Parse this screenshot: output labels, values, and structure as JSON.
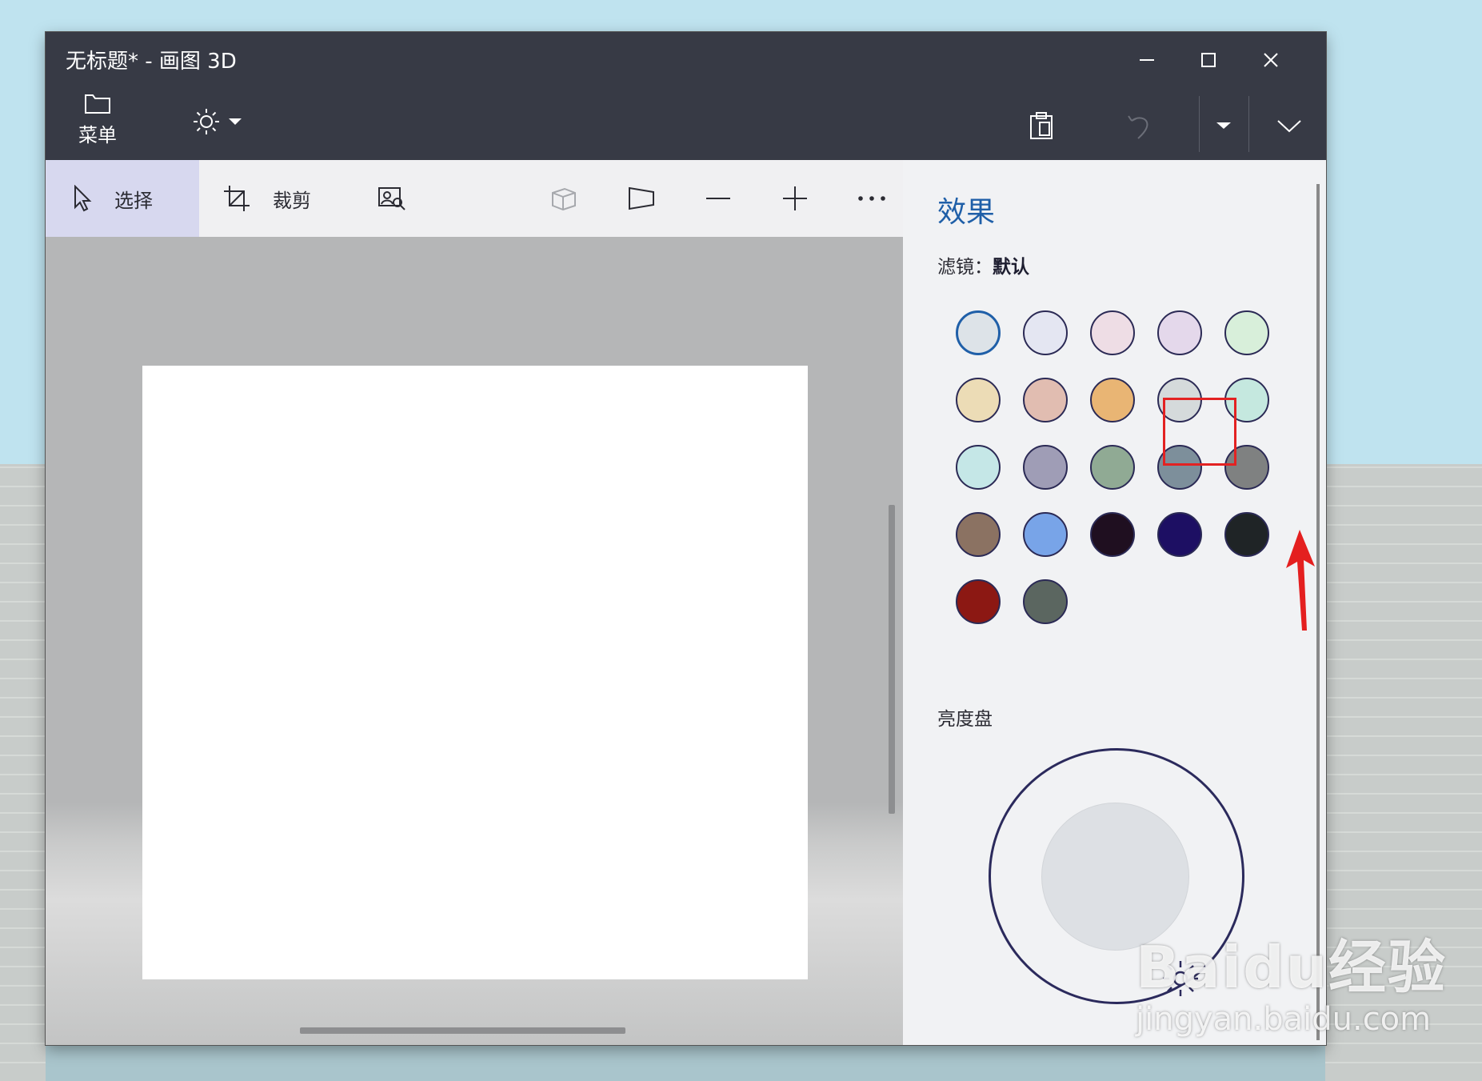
{
  "window": {
    "title": "无标题* - 画图 3D",
    "controls": [
      "minimize",
      "maximize",
      "close"
    ]
  },
  "top_bar": {
    "menu_label": "菜单",
    "menu_icon": "folder-icon",
    "brightness_icon": "sun-icon",
    "right_icons": [
      "paste-icon",
      "undo-icon",
      "dropdown-icon",
      "expand-chevron-icon"
    ]
  },
  "toolbar": {
    "select_label": "选择",
    "crop_label": "裁剪",
    "icons": [
      "magic-select-icon",
      "3d-view-icon",
      "perspective-icon",
      "zoom-out-icon",
      "zoom-in-icon",
      "more-icon"
    ]
  },
  "panel": {
    "title": "效果",
    "filter_prefix": "滤镜：",
    "filter_value": "默认",
    "swatches": [
      "#dde3e8",
      "#e4e6f2",
      "#eedde5",
      "#e4d8eb",
      "#d8efda",
      "#ecdcb6",
      "#e1bdb1",
      "#e9b574",
      "#d5dadb",
      "#c5e8df",
      "#c5e7e7",
      "#9f9db6",
      "#90aa94",
      "#7d8f9b",
      "#7f8181",
      "#8b7262",
      "#78a4e8",
      "#1f0f20",
      "#1d0f63",
      "#1f2426",
      "#8c1813",
      "#5b6660"
    ],
    "selected_swatch": 0,
    "highlighted_swatch": 14,
    "light_dial_label": "亮度盘"
  },
  "watermark": {
    "logo": "Baidu经验",
    "url": "jingyan.baidu.com"
  },
  "colors": {
    "titlebar": "#373a45",
    "accent": "#1f5fa8",
    "highlight": "#e32222"
  }
}
